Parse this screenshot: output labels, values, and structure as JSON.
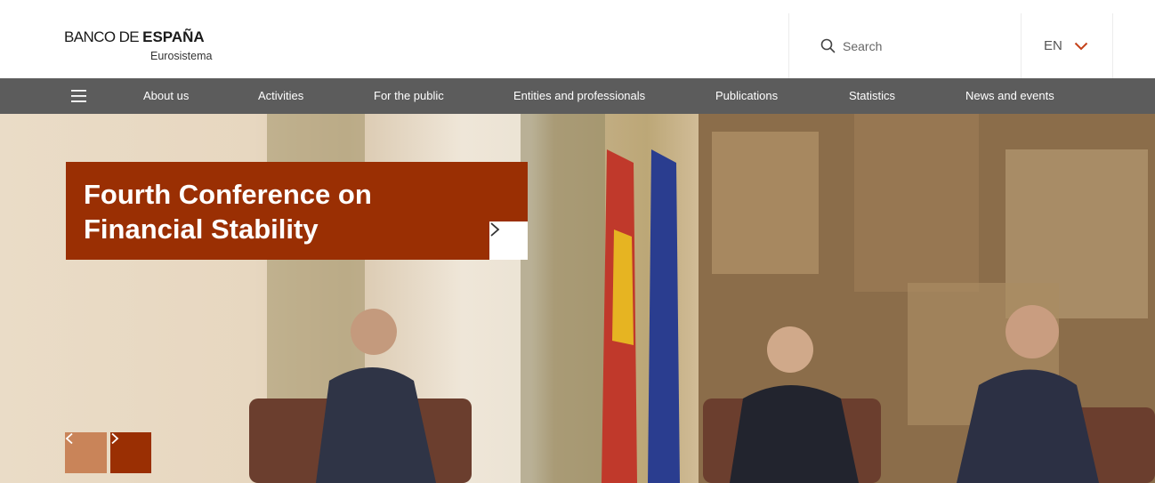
{
  "brand": {
    "name_light": "BANCO DE ",
    "name_bold": "ESPAÑA",
    "subtitle": "Eurosistema"
  },
  "search": {
    "label": "Search",
    "icon": "search-icon"
  },
  "language": {
    "current": "EN",
    "icon": "chevron-down-icon"
  },
  "nav": {
    "menu_icon": "hamburger-menu-icon",
    "items": [
      {
        "label": "About us"
      },
      {
        "label": "Activities"
      },
      {
        "label": "For the public"
      },
      {
        "label": "Entities and professionals"
      },
      {
        "label": "Publications"
      },
      {
        "label": "Statistics"
      },
      {
        "label": "News and events"
      }
    ]
  },
  "hero": {
    "headline": "Fourth Conference on Financial Stability",
    "arrow_icon": "chevron-right-icon",
    "carousel": {
      "prev_icon": "chevron-left-icon",
      "next_icon": "chevron-right-icon"
    }
  },
  "colors": {
    "accent": "#9a2f03",
    "accent_light": "#c98459",
    "nav_bg": "#5c5c5c",
    "chevron": "#c4421a"
  }
}
